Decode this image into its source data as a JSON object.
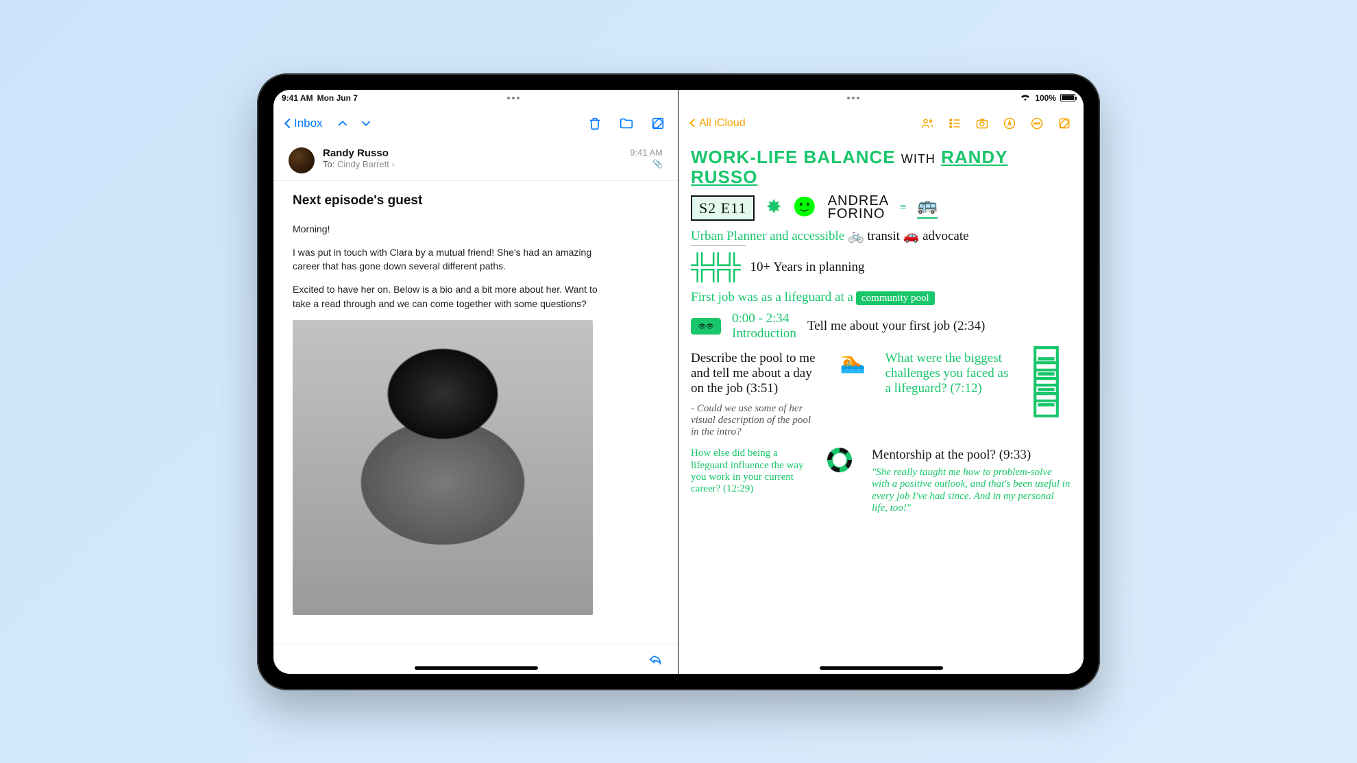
{
  "status": {
    "time": "9:41 AM",
    "date": "Mon Jun 7",
    "wifi": "wifi",
    "battery_pct": "100%"
  },
  "mail": {
    "back_label": "Inbox",
    "sender": "Randy Russo",
    "to_label": "To:",
    "recipient": "Cindy Barrett",
    "timestamp": "9:41 AM",
    "subject": "Next episode's guest",
    "body_p1": "Morning!",
    "body_p2": "I was put in touch with Clara by a mutual friend! She's had an amazing career that has gone down several different paths.",
    "body_p3": "Excited to have her on. Below is a bio and a bit more about her. Want to take a read through and we can come together with some questions?"
  },
  "notes": {
    "back_label": "All iCloud",
    "title_main": "WORK-LIFE BALANCE",
    "title_with": "WITH",
    "title_name": "RANDY RUSSO",
    "episode_tag": "S2 E11",
    "guest_first": "ANDREA",
    "guest_last": "FORINO",
    "tagline_a": "Urban Planner and accessible",
    "tagline_b": "transit",
    "tagline_c": "advocate",
    "years": "10+ Years in planning",
    "firstjob_line": "First job was as a lifeguard at a",
    "firstjob_tag": "community pool",
    "intro_time": "0:00 - 2:34",
    "intro_label": "Introduction",
    "q1": "Tell me about your first job (2:34)",
    "q2": "Describe the pool to me and tell me about a day on the job (3:51)",
    "q2_sub": "- Could we use some of her visual description of the pool in the intro?",
    "q3": "What were the biggest challenges you faced as a lifeguard? (7:12)",
    "q4": "How else did being a lifeguard influence the way you work in your current career? (12:29)",
    "q5": "Mentorship at the pool? (9:33)",
    "q5_quote": "\"She really taught me how to problem-solve with a positive outlook, and that's been useful in every job I've had since. And in my personal life, too!\""
  }
}
